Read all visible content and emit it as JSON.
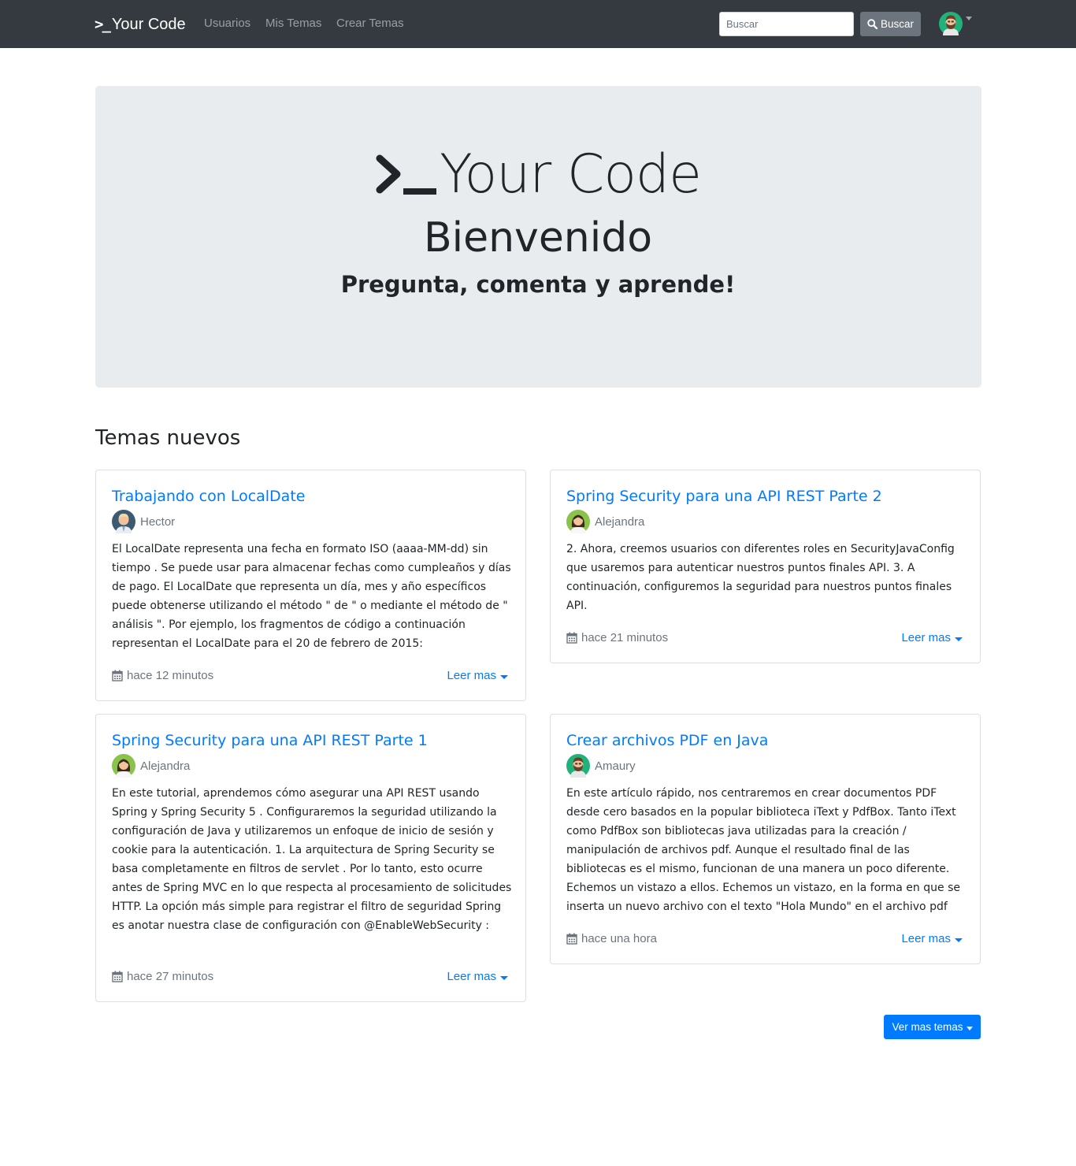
{
  "navbar": {
    "brand": "Your Code",
    "brand_prompt": ">_",
    "links": [
      "Usuarios",
      "Mis Temas",
      "Crear Temas"
    ],
    "search_placeholder": "Buscar",
    "search_button": "Buscar",
    "avatar": "bearded-user-avatar"
  },
  "jumbotron": {
    "prompt": ">_",
    "title": "Your Code",
    "subtitle": "Bienvenido",
    "lead": "Pregunta, comenta y aprende!"
  },
  "section_title": "Temas nuevos",
  "posts": [
    {
      "title": "Trabajando con LocalDate",
      "author": "Hector",
      "body": "El LocalDate representa una fecha en formato ISO (aaaa-MM-dd) sin tiempo . Se puede usar para almacenar fechas como cumpleaños y días de pago. El LocalDate que representa un día, mes y año específicos puede obtenerse utilizando el método \" de \" o mediante el método de \" análisis \". Por ejemplo, los fragmentos de código a continuación representan el LocalDate para el 20 de febrero de 2015:",
      "time": "hace 12 minutos",
      "more": "Leer mas"
    },
    {
      "title": "Spring Security para una API REST Parte 2",
      "author": "Alejandra",
      "body": "2. Ahora, creemos usuarios con diferentes roles en SecurityJavaConfig que usaremos para autenticar nuestros puntos finales API. 3. A continuación, configuremos la seguridad para nuestros puntos finales API.",
      "time": "hace 21 minutos",
      "more": "Leer mas"
    },
    {
      "title": "Spring Security para una API REST Parte 1",
      "author": "Alejandra",
      "body": "En este tutorial, aprendemos cómo asegurar una API REST usando Spring y Spring Security 5 . Configuraremos la seguridad utilizando la configuración de Java y utilizaremos un enfoque de inicio de sesión y cookie para la autenticación. 1. La arquitectura de Spring Security se basa completamente en filtros de servlet . Por lo tanto, esto ocurre antes de Spring MVC en lo que respecta al procesamiento de solicitudes HTTP. La opción más simple para registrar el filtro de seguridad Spring es anotar nuestra clase de configuración con @EnableWebSecurity :",
      "time": "hace 27 minutos",
      "more": "Leer mas"
    },
    {
      "title": "Crear archivos PDF en Java",
      "author": "Amaury",
      "body": "En este artículo rápido, nos centraremos en crear documentos PDF desde cero basados en la popular biblioteca iText y PdfBox. Tanto iText como PdfBox son bibliotecas java utilizadas para la creación / manipulación de archivos pdf. Aunque el resultado final de las bibliotecas es el mismo, funcionan de una manera un poco diferente. Echemos un vistazo a ellos. Echemos un vistazo, en la forma en que se inserta un nuevo archivo con el texto \"Hola Mundo\" en el archivo pdf",
      "time": "hace una hora",
      "more": "Leer mas"
    }
  ],
  "more_button": "Ver mas temas",
  "colors": {
    "navbar": "#343a40",
    "primary": "#007bff",
    "secondary": "#6c757d",
    "jumbotron": "#e9ecef"
  }
}
